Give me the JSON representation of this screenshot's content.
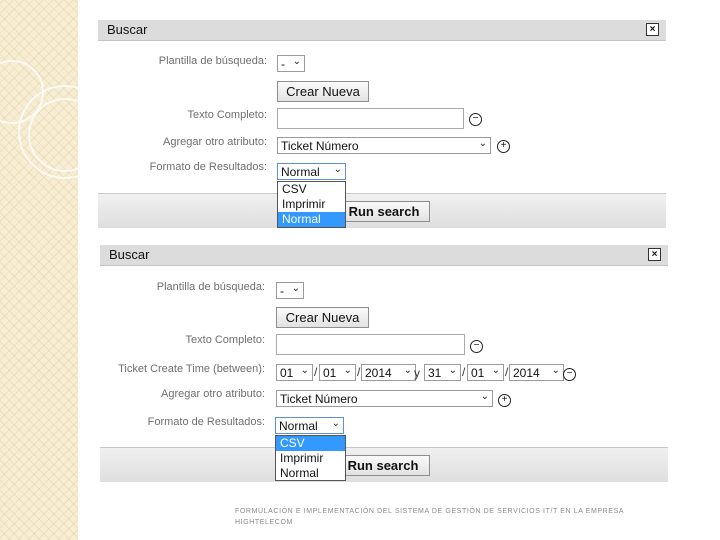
{
  "panel1": {
    "title": "Buscar",
    "close_glyph": "×",
    "template_label": "Plantilla de búsqueda:",
    "template_value": "-",
    "create_new": "Crear Nueva",
    "fulltext_label": "Texto Completo:",
    "add_attr_label": "Agregar otro atributo:",
    "add_attr_value": "Ticket Número",
    "format_label": "Formato de Resultados:",
    "format_value": "Normal",
    "format_options": [
      "CSV",
      "Imprimir",
      "Normal"
    ],
    "format_selected": "Normal",
    "run_search": "Run search",
    "remove_glyph": "−",
    "add_glyph": "+"
  },
  "panel2": {
    "title": "Buscar",
    "close_glyph": "×",
    "template_label": "Plantilla de búsqueda:",
    "template_value": "-",
    "create_new": "Crear Nueva",
    "fulltext_label": "Texto Completo:",
    "time_label": "Ticket Create Time (between):",
    "start_day": "01",
    "start_month": "01",
    "start_year": "2014",
    "between_word": "y",
    "end_day": "31",
    "end_month": "01",
    "end_year": "2014",
    "date_sep": "/",
    "add_attr_label": "Agregar otro atributo:",
    "add_attr_value": "Ticket Número",
    "format_label": "Formato de Resultados:",
    "format_value": "Normal",
    "format_options": [
      "CSV",
      "Imprimir",
      "Normal"
    ],
    "format_selected": "CSV",
    "run_search": "Run search",
    "remove_glyph": "−",
    "add_glyph": "+"
  },
  "footer": {
    "text": "FORMULACIÓN E IMPLEMENTACIÓN DEL SISTEMA DE GESTIÓN DE SERVICIOS IT/T EN LA EMPRESA HIGHTELECOM"
  },
  "colors": {
    "selected_option": "#3399ff",
    "header_bg": "#dcdcdc",
    "side_pattern": "#f7edd3"
  }
}
